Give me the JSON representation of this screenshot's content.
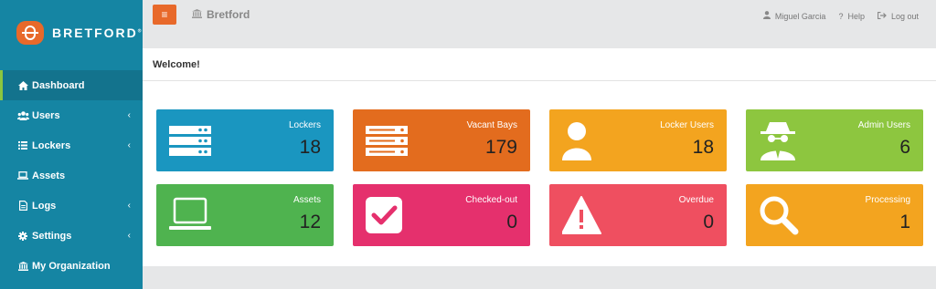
{
  "app": {
    "logo_text": "BRETFORD",
    "logo_mark": "®",
    "brand": "Bretford",
    "menu_toggle": "≡"
  },
  "user_menu": {
    "user": "Miguel Garcia",
    "help": "Help",
    "logout": "Log out"
  },
  "sidebar": {
    "items": [
      {
        "label": "Dashboard",
        "icon": "home-icon"
      },
      {
        "label": "Users",
        "icon": "users-icon"
      },
      {
        "label": "Lockers",
        "icon": "list-icon"
      },
      {
        "label": "Assets",
        "icon": "laptop-icon"
      },
      {
        "label": "Logs",
        "icon": "file-icon"
      },
      {
        "label": "Settings",
        "icon": "gear-icon"
      },
      {
        "label": "My Organization",
        "icon": "bank-icon"
      }
    ]
  },
  "welcome": "Welcome!",
  "cards": [
    {
      "label": "Lockers",
      "value": "18",
      "color": "#1a96c0",
      "icon": "server-icon"
    },
    {
      "label": "Vacant Bays",
      "value": "179",
      "color": "#e36c1e",
      "icon": "server-icon"
    },
    {
      "label": "Locker Users",
      "value": "18",
      "color": "#f3a41f",
      "icon": "user-icon"
    },
    {
      "label": "Admin Users",
      "value": "6",
      "color": "#8dc63f",
      "icon": "spy-icon"
    },
    {
      "label": "Assets",
      "value": "12",
      "color": "#4fb34f",
      "icon": "laptop-icon"
    },
    {
      "label": "Checked-out",
      "value": "0",
      "color": "#e5306d",
      "icon": "checkbox-icon"
    },
    {
      "label": "Overdue",
      "value": "0",
      "color": "#ef4f60",
      "icon": "warning-icon"
    },
    {
      "label": "Processing",
      "value": "1",
      "color": "#f3a41f",
      "icon": "magnifier-icon"
    }
  ]
}
